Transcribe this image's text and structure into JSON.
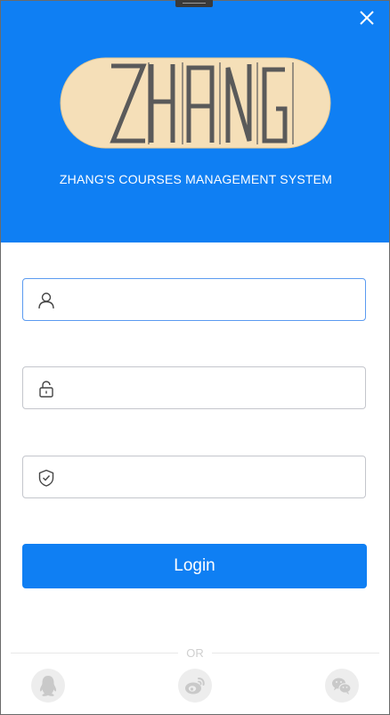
{
  "header": {
    "logo_text": "ZHANG",
    "subtitle": "ZHANG'S COURSES MANAGEMENT SYSTEM"
  },
  "form": {
    "username": {
      "icon": "user-icon",
      "value": "",
      "placeholder": ""
    },
    "password": {
      "icon": "lock-icon",
      "value": "",
      "placeholder": ""
    },
    "captcha": {
      "icon": "shield-check-icon",
      "value": "",
      "placeholder": ""
    },
    "login_label": "Login"
  },
  "divider": {
    "label": "OR"
  },
  "social": [
    {
      "icon": "qq-icon"
    },
    {
      "icon": "weibo-icon"
    },
    {
      "icon": "wechat-icon"
    }
  ],
  "colors": {
    "primary": "#0f7ff3",
    "logo_fill": "#f5dfb8",
    "logo_text": "#5a5a5a",
    "social_bg": "#ededed",
    "social_fg": "#c9c9c9"
  }
}
